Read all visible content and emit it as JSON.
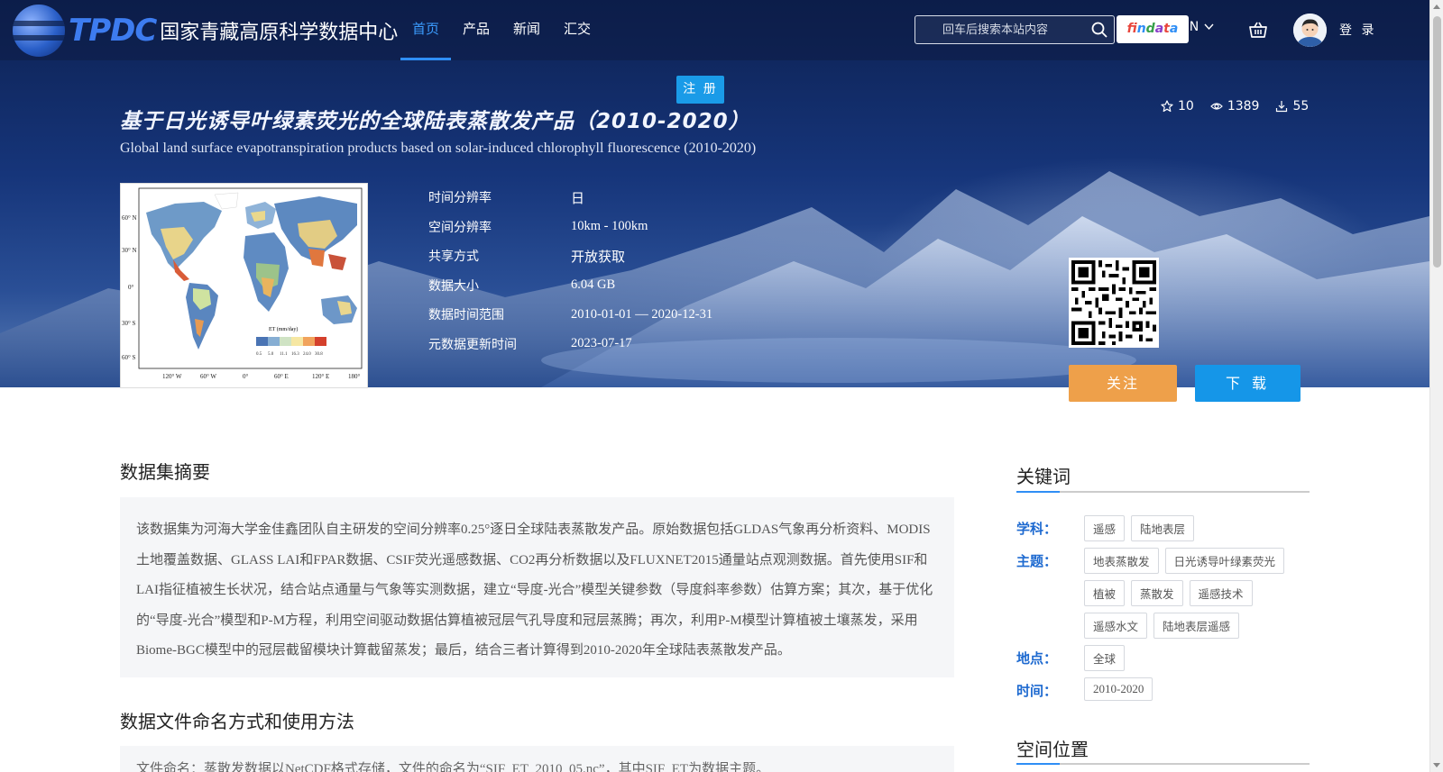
{
  "nav": {
    "logo_abbr": "TPDC",
    "logo_name": "国家青藏高原科学数据中心",
    "links": [
      {
        "label": "首页",
        "active": true
      },
      {
        "label": "产品",
        "active": false
      },
      {
        "label": "新闻",
        "active": false
      },
      {
        "label": "汇交",
        "active": false
      }
    ],
    "search_placeholder": "回车后搜索本站内容",
    "findata_letters": [
      "f",
      "i",
      "n",
      "d",
      "a",
      "t",
      "a"
    ],
    "lang": "CN",
    "login": "登 录",
    "register": "注 册"
  },
  "dataset": {
    "title_cn": "基于日光诱导叶绿素荧光的全球陆表蒸散发产品（2010-2020）",
    "title_en": "Global land surface evapotranspiration products based on solar-induced chlorophyll fluorescence (2010-2020)",
    "stars": "10",
    "views": "1389",
    "downloads": "55",
    "meta": [
      {
        "key": "时间分辨率",
        "value": "日",
        "cn": true
      },
      {
        "key": "空间分辨率",
        "value": "10km - 100km",
        "cn": false
      },
      {
        "key": "共享方式",
        "value": "开放获取",
        "cn": true
      },
      {
        "key": "数据大小",
        "value": "6.04 GB",
        "cn": false
      },
      {
        "key": "数据时间范围",
        "value": "2010-01-01 — 2020-12-31",
        "cn": false
      },
      {
        "key": "元数据更新时间",
        "value": "2023-07-17",
        "cn": false
      }
    ],
    "follow_label": "关注",
    "download_label": "下 载",
    "map_labels": {
      "lat": [
        "60° N",
        "30° N",
        "0°",
        "30° S",
        "60° S"
      ],
      "lon": [
        "120° W",
        "60° W",
        "0°",
        "60° E",
        "120° E",
        "180°"
      ],
      "legend_title": "ET (mm/day)",
      "legend_ticks": [
        "0.5",
        "5.0",
        "11.1",
        "16.3",
        "24.0",
        "30.8"
      ],
      "legend_colors": [
        "#4a74b4",
        "#86aed3",
        "#cfe3c4",
        "#f6e7a3",
        "#f1a35c",
        "#d4402c"
      ]
    }
  },
  "abstract": {
    "title": "数据集摘要",
    "lines": [
      "该数据集为河海大学金佳鑫团队自主研发的空间分辨率0.25°逐日全球陆表蒸散发产品。原始数据包括GLDAS气象再分析资料、MODIS",
      "土地覆盖数据、GLASS LAI和FPAR数据、CSIF荧光遥感数据、CO2再分析数据以及FLUXNET2015通量站点观测数据。首先使用SIF和",
      "LAI指征植被生长状况，结合站点通量与气象等实测数据，建立“导度-光合”模型关键参数（导度斜率参数）估算方案；其次，基于优化",
      "的“导度-光合”模型和P-M方程，利用空间驱动数据估算植被冠层气孔导度和冠层蒸腾；再次，利用P-M模型计算植被土壤蒸发，采用",
      "Biome-BGC模型中的冠层截留模块计算截留蒸发；最后，结合三者计算得到2010-2020年全球陆表蒸散发产品。"
    ]
  },
  "naming": {
    "title": "数据文件命名方式和使用方法",
    "text": "文件命名：蒸散发数据以NetCDF格式存储，文件的命名为“SIF_ET_2010_05.nc”，其中SIF_ET为数据主题。"
  },
  "keywords": {
    "title": "关键词",
    "groups": [
      {
        "label": "学科：",
        "tags": [
          "遥感",
          "陆地表层"
        ]
      },
      {
        "label": "主题：",
        "tags": [
          "地表蒸散发",
          "日光诱导叶绿素荧光",
          "植被",
          "蒸散发",
          "遥感技术",
          "遥感水文",
          "陆地表层遥感"
        ]
      },
      {
        "label": "地点：",
        "tags": [
          "全球"
        ]
      },
      {
        "label": "时间：",
        "tags": [
          "2010-2020"
        ]
      }
    ]
  },
  "spatial": {
    "title": "空间位置"
  }
}
